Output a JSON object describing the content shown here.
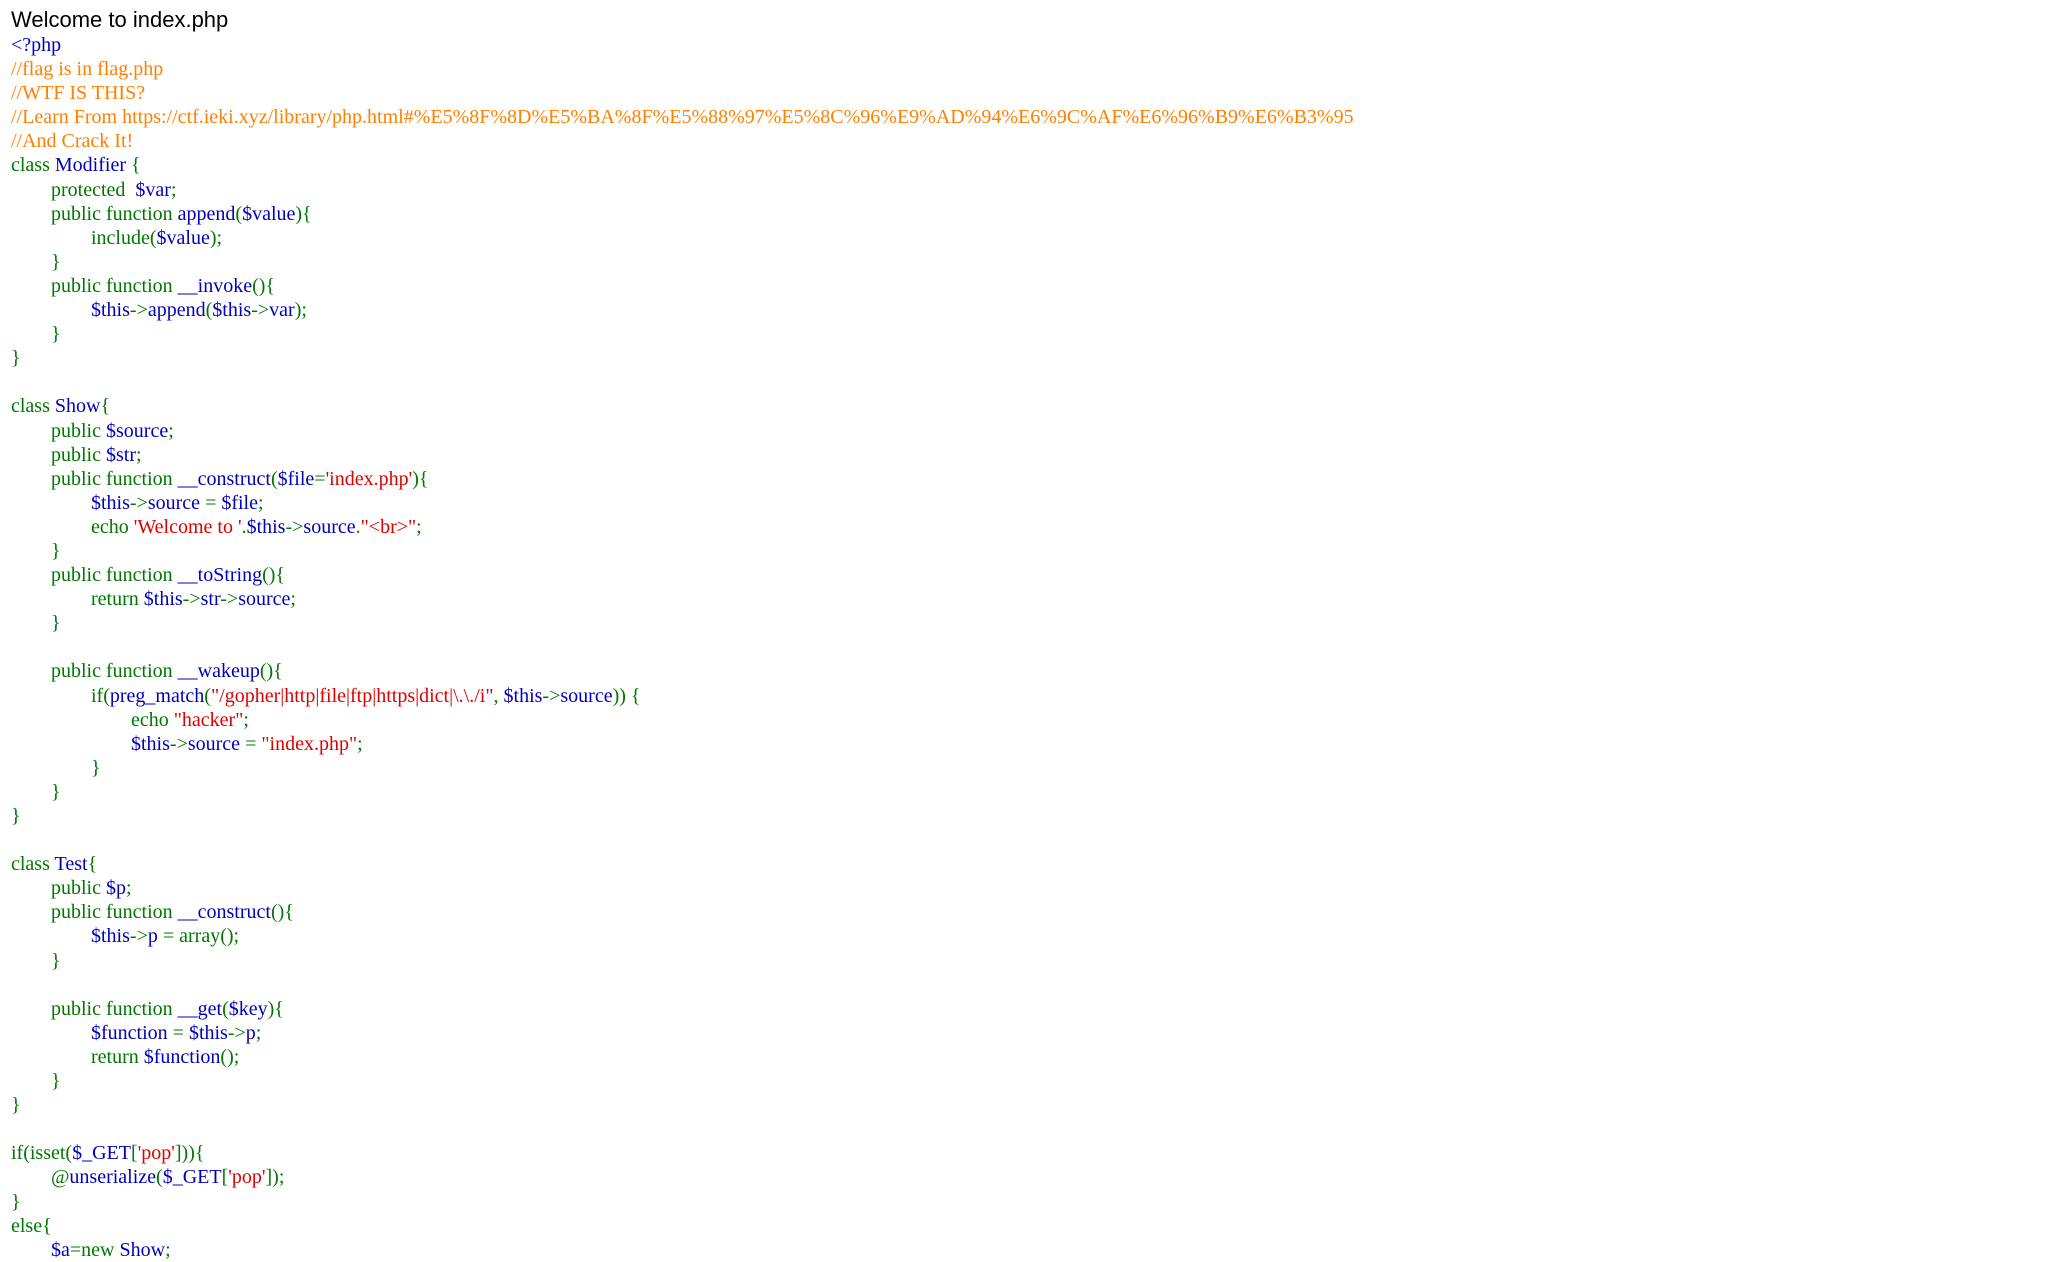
{
  "page": {
    "welcome_text": "Welcome to index.php"
  },
  "colors": {
    "default": "#0000BB",
    "keyword": "#007700",
    "comment": "#FF8000",
    "string": "#DD0000",
    "background": "#FFFFFF"
  },
  "source_code": {
    "language": "php",
    "lines": [
      [
        [
          "default",
          "<?php"
        ]
      ],
      [
        [
          "comment",
          "//flag is in flag.php"
        ]
      ],
      [
        [
          "comment",
          "//WTF IS THIS?"
        ]
      ],
      [
        [
          "comment",
          "//Learn From https://ctf.ieki.xyz/library/php.html#%E5%8F%8D%E5%BA%8F%E5%88%97%E5%8C%96%E9%AD%94%E6%9C%AF%E6%96%B9%E6%B3%95"
        ]
      ],
      [
        [
          "comment",
          "//And Crack It!"
        ]
      ],
      [
        [
          "keyword",
          "class "
        ],
        [
          "default",
          "Modifier "
        ],
        [
          "keyword",
          "{"
        ]
      ],
      [
        [
          "keyword",
          "\tprotected  "
        ],
        [
          "default",
          "$var"
        ],
        [
          "keyword",
          ";"
        ]
      ],
      [
        [
          "keyword",
          "\tpublic function "
        ],
        [
          "default",
          "append"
        ],
        [
          "keyword",
          "("
        ],
        [
          "default",
          "$value"
        ],
        [
          "keyword",
          "){"
        ]
      ],
      [
        [
          "keyword",
          "\t\tinclude("
        ],
        [
          "default",
          "$value"
        ],
        [
          "keyword",
          ");"
        ]
      ],
      [
        [
          "keyword",
          "\t}"
        ]
      ],
      [
        [
          "keyword",
          "\tpublic function "
        ],
        [
          "default",
          "__invoke"
        ],
        [
          "keyword",
          "(){"
        ]
      ],
      [
        [
          "keyword",
          "\t\t"
        ],
        [
          "default",
          "$this"
        ],
        [
          "keyword",
          "->"
        ],
        [
          "default",
          "append"
        ],
        [
          "keyword",
          "("
        ],
        [
          "default",
          "$this"
        ],
        [
          "keyword",
          "->"
        ],
        [
          "default",
          "var"
        ],
        [
          "keyword",
          ");"
        ]
      ],
      [
        [
          "keyword",
          "\t}"
        ]
      ],
      [
        [
          "keyword",
          "}"
        ]
      ],
      [
        [
          "default",
          ""
        ]
      ],
      [
        [
          "keyword",
          "class "
        ],
        [
          "default",
          "Show"
        ],
        [
          "keyword",
          "{"
        ]
      ],
      [
        [
          "keyword",
          "\tpublic "
        ],
        [
          "default",
          "$source"
        ],
        [
          "keyword",
          ";"
        ]
      ],
      [
        [
          "keyword",
          "\tpublic "
        ],
        [
          "default",
          "$str"
        ],
        [
          "keyword",
          ";"
        ]
      ],
      [
        [
          "keyword",
          "\tpublic function "
        ],
        [
          "default",
          "__construct"
        ],
        [
          "keyword",
          "("
        ],
        [
          "default",
          "$file"
        ],
        [
          "keyword",
          "="
        ],
        [
          "string",
          "'index.php'"
        ],
        [
          "keyword",
          "){"
        ]
      ],
      [
        [
          "keyword",
          "\t\t"
        ],
        [
          "default",
          "$this"
        ],
        [
          "keyword",
          "->"
        ],
        [
          "default",
          "source "
        ],
        [
          "keyword",
          "= "
        ],
        [
          "default",
          "$file"
        ],
        [
          "keyword",
          ";"
        ]
      ],
      [
        [
          "keyword",
          "\t\techo "
        ],
        [
          "string",
          "'Welcome to '"
        ],
        [
          "keyword",
          "."
        ],
        [
          "default",
          "$this"
        ],
        [
          "keyword",
          "->"
        ],
        [
          "default",
          "source"
        ],
        [
          "keyword",
          "."
        ],
        [
          "string",
          "\"<br>\""
        ],
        [
          "keyword",
          ";"
        ]
      ],
      [
        [
          "keyword",
          "\t}"
        ]
      ],
      [
        [
          "keyword",
          "\tpublic function "
        ],
        [
          "default",
          "__toString"
        ],
        [
          "keyword",
          "(){"
        ]
      ],
      [
        [
          "keyword",
          "\t\treturn "
        ],
        [
          "default",
          "$this"
        ],
        [
          "keyword",
          "->"
        ],
        [
          "default",
          "str"
        ],
        [
          "keyword",
          "->"
        ],
        [
          "default",
          "source"
        ],
        [
          "keyword",
          ";"
        ]
      ],
      [
        [
          "keyword",
          "\t}"
        ]
      ],
      [
        [
          "default",
          ""
        ]
      ],
      [
        [
          "keyword",
          "\tpublic function "
        ],
        [
          "default",
          "__wakeup"
        ],
        [
          "keyword",
          "(){"
        ]
      ],
      [
        [
          "keyword",
          "\t\tif("
        ],
        [
          "default",
          "preg_match"
        ],
        [
          "keyword",
          "("
        ],
        [
          "string",
          "\"/gopher|http|file|ftp|https|dict|\\.\\./i\""
        ],
        [
          "keyword",
          ", "
        ],
        [
          "default",
          "$this"
        ],
        [
          "keyword",
          "->"
        ],
        [
          "default",
          "source"
        ],
        [
          "keyword",
          ")) {"
        ]
      ],
      [
        [
          "keyword",
          "\t\t\techo "
        ],
        [
          "string",
          "\"hacker\""
        ],
        [
          "keyword",
          ";"
        ]
      ],
      [
        [
          "keyword",
          "\t\t\t"
        ],
        [
          "default",
          "$this"
        ],
        [
          "keyword",
          "->"
        ],
        [
          "default",
          "source "
        ],
        [
          "keyword",
          "= "
        ],
        [
          "string",
          "\"index.php\""
        ],
        [
          "keyword",
          ";"
        ]
      ],
      [
        [
          "keyword",
          "\t\t}"
        ]
      ],
      [
        [
          "keyword",
          "\t}"
        ]
      ],
      [
        [
          "keyword",
          "}"
        ]
      ],
      [
        [
          "default",
          ""
        ]
      ],
      [
        [
          "keyword",
          "class "
        ],
        [
          "default",
          "Test"
        ],
        [
          "keyword",
          "{"
        ]
      ],
      [
        [
          "keyword",
          "\tpublic "
        ],
        [
          "default",
          "$p"
        ],
        [
          "keyword",
          ";"
        ]
      ],
      [
        [
          "keyword",
          "\tpublic function "
        ],
        [
          "default",
          "__construct"
        ],
        [
          "keyword",
          "(){"
        ]
      ],
      [
        [
          "keyword",
          "\t\t"
        ],
        [
          "default",
          "$this"
        ],
        [
          "keyword",
          "->"
        ],
        [
          "default",
          "p "
        ],
        [
          "keyword",
          "= array();"
        ]
      ],
      [
        [
          "keyword",
          "\t}"
        ]
      ],
      [
        [
          "default",
          ""
        ]
      ],
      [
        [
          "keyword",
          "\tpublic function "
        ],
        [
          "default",
          "__get"
        ],
        [
          "keyword",
          "("
        ],
        [
          "default",
          "$key"
        ],
        [
          "keyword",
          "){"
        ]
      ],
      [
        [
          "keyword",
          "\t\t"
        ],
        [
          "default",
          "$function "
        ],
        [
          "keyword",
          "= "
        ],
        [
          "default",
          "$this"
        ],
        [
          "keyword",
          "->"
        ],
        [
          "default",
          "p"
        ],
        [
          "keyword",
          ";"
        ]
      ],
      [
        [
          "keyword",
          "\t\treturn "
        ],
        [
          "default",
          "$function"
        ],
        [
          "keyword",
          "();"
        ]
      ],
      [
        [
          "keyword",
          "\t}"
        ]
      ],
      [
        [
          "keyword",
          "}"
        ]
      ],
      [
        [
          "default",
          ""
        ]
      ],
      [
        [
          "keyword",
          "if(isset("
        ],
        [
          "default",
          "$_GET"
        ],
        [
          "keyword",
          "["
        ],
        [
          "string",
          "'pop'"
        ],
        [
          "keyword",
          "])){"
        ]
      ],
      [
        [
          "keyword",
          "\t@"
        ],
        [
          "default",
          "unserialize"
        ],
        [
          "keyword",
          "("
        ],
        [
          "default",
          "$_GET"
        ],
        [
          "keyword",
          "["
        ],
        [
          "string",
          "'pop'"
        ],
        [
          "keyword",
          "]);"
        ]
      ],
      [
        [
          "keyword",
          "}"
        ]
      ],
      [
        [
          "keyword",
          "else{"
        ]
      ],
      [
        [
          "keyword",
          "\t"
        ],
        [
          "default",
          "$a"
        ],
        [
          "keyword",
          "=new "
        ],
        [
          "default",
          "Show"
        ],
        [
          "keyword",
          ";"
        ]
      ]
    ]
  }
}
